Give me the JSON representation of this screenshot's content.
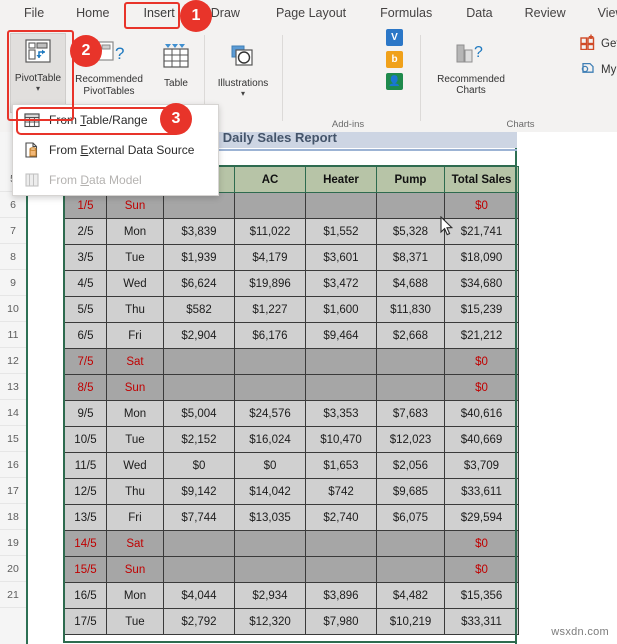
{
  "ribbon": {
    "tabs": [
      {
        "label": "File",
        "key": "file"
      },
      {
        "label": "Home",
        "key": "home"
      },
      {
        "label": "Insert",
        "key": "insert"
      },
      {
        "label": "Draw",
        "key": "draw"
      },
      {
        "label": "Page Layout",
        "key": "pagelayout"
      },
      {
        "label": "Formulas",
        "key": "formulas"
      },
      {
        "label": "Data",
        "key": "data"
      },
      {
        "label": "Review",
        "key": "review"
      },
      {
        "label": "View",
        "key": "view"
      }
    ],
    "active_tab": "Insert",
    "pivottable_label": "PivotTable",
    "recommended_pivottables_label": "Recommended PivotTables",
    "table_label": "Table",
    "illustrations_label": "Illustrations",
    "get_addins_label": "Get Add-ins",
    "my_addins_label": "My Add-ins",
    "addins_group_label": "Add-ins",
    "recommended_charts_label": "Recommended Charts",
    "charts_group_label": "Charts"
  },
  "dropdown": {
    "items": [
      {
        "label_pre": "From ",
        "label_key": "T",
        "label_post": "able/Range",
        "icon": "table-range-icon",
        "disabled": false
      },
      {
        "label_pre": "From ",
        "label_key": "E",
        "label_post": "xternal Data Source",
        "icon": "external-data-icon",
        "disabled": false
      },
      {
        "label_pre": "From ",
        "label_key": "D",
        "label_post": "ata Model",
        "icon": "data-model-icon",
        "disabled": true
      }
    ]
  },
  "sheet": {
    "title": "w to Make Daily Sales Report",
    "row_headers": [
      "5",
      "6",
      "7",
      "8",
      "9",
      "10",
      "11",
      "12",
      "13",
      "14",
      "15",
      "16",
      "17",
      "18",
      "19",
      "20",
      "21"
    ],
    "columns": [
      "",
      "",
      "",
      "AC",
      "Heater",
      "Pump",
      "Total Sales"
    ],
    "headers_visible": [
      "AC",
      "Heater",
      "Pump",
      "Total Sales"
    ],
    "rows": [
      {
        "row": "5",
        "date": "1/5",
        "day": "Sun",
        "c1": "",
        "ac": "",
        "heater": "",
        "pump": "",
        "total": "$0",
        "weekend": true
      },
      {
        "row": "6",
        "date": "2/5",
        "day": "Mon",
        "c1": "$3,839",
        "ac": "$11,022",
        "heater": "$1,552",
        "pump": "$5,328",
        "total": "$21,741",
        "weekend": false
      },
      {
        "row": "7",
        "date": "3/5",
        "day": "Tue",
        "c1": "$1,939",
        "ac": "$4,179",
        "heater": "$3,601",
        "pump": "$8,371",
        "total": "$18,090",
        "weekend": false
      },
      {
        "row": "8",
        "date": "4/5",
        "day": "Wed",
        "c1": "$6,624",
        "ac": "$19,896",
        "heater": "$3,472",
        "pump": "$4,688",
        "total": "$34,680",
        "weekend": false
      },
      {
        "row": "9",
        "date": "5/5",
        "day": "Thu",
        "c1": "$582",
        "ac": "$1,227",
        "heater": "$1,600",
        "pump": "$11,830",
        "total": "$15,239",
        "weekend": false
      },
      {
        "row": "10",
        "date": "6/5",
        "day": "Fri",
        "c1": "$2,904",
        "ac": "$6,176",
        "heater": "$9,464",
        "pump": "$2,668",
        "total": "$21,212",
        "weekend": false
      },
      {
        "row": "11",
        "date": "7/5",
        "day": "Sat",
        "c1": "",
        "ac": "",
        "heater": "",
        "pump": "",
        "total": "$0",
        "weekend": true
      },
      {
        "row": "12",
        "date": "8/5",
        "day": "Sun",
        "c1": "",
        "ac": "",
        "heater": "",
        "pump": "",
        "total": "$0",
        "weekend": true
      },
      {
        "row": "13",
        "date": "9/5",
        "day": "Mon",
        "c1": "$5,004",
        "ac": "$24,576",
        "heater": "$3,353",
        "pump": "$7,683",
        "total": "$40,616",
        "weekend": false
      },
      {
        "row": "14",
        "date": "10/5",
        "day": "Tue",
        "c1": "$2,152",
        "ac": "$16,024",
        "heater": "$10,470",
        "pump": "$12,023",
        "total": "$40,669",
        "weekend": false
      },
      {
        "row": "15",
        "date": "11/5",
        "day": "Wed",
        "c1": "$0",
        "ac": "$0",
        "heater": "$1,653",
        "pump": "$2,056",
        "total": "$3,709",
        "weekend": false
      },
      {
        "row": "16",
        "date": "12/5",
        "day": "Thu",
        "c1": "$9,142",
        "ac": "$14,042",
        "heater": "$742",
        "pump": "$9,685",
        "total": "$33,611",
        "weekend": false
      },
      {
        "row": "17",
        "date": "13/5",
        "day": "Fri",
        "c1": "$7,744",
        "ac": "$13,035",
        "heater": "$2,740",
        "pump": "$6,075",
        "total": "$29,594",
        "weekend": false
      },
      {
        "row": "18",
        "date": "14/5",
        "day": "Sat",
        "c1": "",
        "ac": "",
        "heater": "",
        "pump": "",
        "total": "$0",
        "weekend": true
      },
      {
        "row": "19",
        "date": "15/5",
        "day": "Sun",
        "c1": "",
        "ac": "",
        "heater": "",
        "pump": "",
        "total": "$0",
        "weekend": true
      },
      {
        "row": "20",
        "date": "16/5",
        "day": "Mon",
        "c1": "$4,044",
        "ac": "$2,934",
        "heater": "$3,896",
        "pump": "$4,482",
        "total": "$15,356",
        "weekend": false
      },
      {
        "row": "21",
        "date": "17/5",
        "day": "Tue",
        "c1": "$2,792",
        "ac": "$12,320",
        "heater": "$7,980",
        "pump": "$10,219",
        "total": "$33,311",
        "weekend": false
      }
    ]
  },
  "callouts": {
    "badges": [
      {
        "number": "1"
      },
      {
        "number": "2"
      },
      {
        "number": "3"
      }
    ],
    "accent_color": "#e8342a"
  },
  "watermark": "wsxdn.com"
}
